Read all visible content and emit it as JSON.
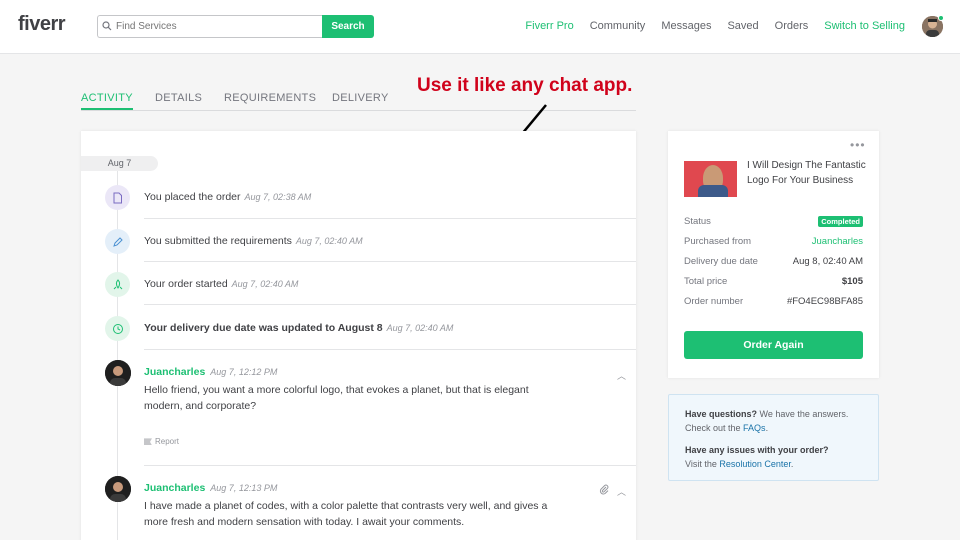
{
  "nav": {
    "logo": "fiverr",
    "search_placeholder": "Find Services",
    "search_button": "Search",
    "links": [
      {
        "label": "Fiverr Pro",
        "color": "#1dbf73"
      },
      {
        "label": "Community"
      },
      {
        "label": "Messages"
      },
      {
        "label": "Saved"
      },
      {
        "label": "Orders"
      },
      {
        "label": "Switch to Selling",
        "color": "#1dbf73"
      }
    ]
  },
  "annotation": "Use it like any chat app.",
  "tabs": [
    "ACTIVITY",
    "DETAILS",
    "REQUIREMENTS",
    "DELIVERY"
  ],
  "activity": {
    "date": "Aug 7",
    "events": [
      {
        "text": "You placed the order",
        "time": "Aug 7, 02:38 AM",
        "icon": "document-icon"
      },
      {
        "text": "You submitted the requirements",
        "time": "Aug 7, 02:40 AM",
        "icon": "pencil-icon"
      },
      {
        "text": "Your order started",
        "time": "Aug 7, 02:40 AM",
        "icon": "rocket-icon"
      },
      {
        "text": "Your delivery due date was updated to August 8",
        "time": "Aug 7, 02:40 AM",
        "icon": "clock-icon"
      }
    ],
    "messages": [
      {
        "name": "Juancharles",
        "time": "Aug 7, 12:12 PM",
        "body": "Hello friend, you want a more colorful logo, that evokes a planet, but that is elegant modern, and corporate?",
        "report": "Report"
      },
      {
        "name": "Juancharles",
        "time": "Aug 7, 12:13 PM",
        "body": "I have made a planet of codes, with a color palette that contrasts very well, and gives a more fresh and modern sensation with today. I await your comments."
      }
    ]
  },
  "order": {
    "title": "I Will Design The Fantastic Logo For Your Business",
    "rows": [
      {
        "key": "Status",
        "value": "Completed"
      },
      {
        "key": "Purchased from",
        "value": "Juancharles"
      },
      {
        "key": "Delivery due date",
        "value": "Aug 8, 02:40 AM"
      },
      {
        "key": "Total price",
        "value": "$105"
      },
      {
        "key": "Order number",
        "value": "#FO4EC98BFA85"
      }
    ],
    "button": "Order Again"
  },
  "help": {
    "q1_bold": "Have questions?",
    "q1_rest": " We have the answers.",
    "q1_line2_pre": "Check out the ",
    "q1_link": "FAQs",
    "q1_end": ".",
    "q2_bold": "Have any issues with your order?",
    "q2_pre": "Visit the ",
    "q2_link": "Resolution Center",
    "q2_end": "."
  }
}
